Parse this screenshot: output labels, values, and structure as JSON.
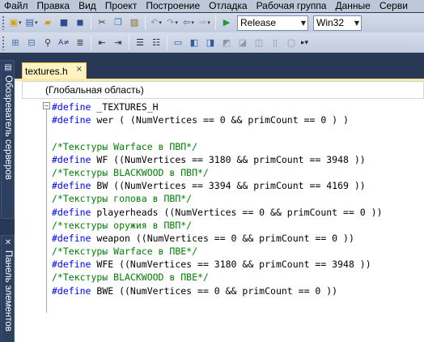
{
  "menubar": {
    "items": [
      "Файл",
      "Правка",
      "Вид",
      "Проект",
      "Построение",
      "Отладка",
      "Рабочая группа",
      "Данные",
      "Серви"
    ]
  },
  "toolbar1": {
    "configuration": "Release",
    "platform": "Win32"
  },
  "sidebar": {
    "tab1_label": "Обозреватель серверов",
    "tab2_label": "Панель элементов"
  },
  "document_tab": {
    "title": "textures.h",
    "close_glyph": "×"
  },
  "editor": {
    "scope": "(Глобальная область)",
    "lines": [
      {
        "parts": [
          {
            "t": "#define",
            "c": "kw"
          },
          {
            "t": " _TEXTURES_H",
            "c": ""
          }
        ]
      },
      {
        "parts": [
          {
            "t": "#define",
            "c": "kw"
          },
          {
            "t": " wer ( (NumVertices == 0 && primCount == 0 ) )",
            "c": ""
          }
        ]
      },
      {
        "parts": [
          {
            "t": "",
            "c": ""
          }
        ]
      },
      {
        "parts": [
          {
            "t": "/*Текстуры Warface в ПВП*/",
            "c": "cm"
          }
        ]
      },
      {
        "parts": [
          {
            "t": "#define",
            "c": "kw"
          },
          {
            "t": " WF ((NumVertices == 3180 && primCount == 3948 ))",
            "c": ""
          }
        ]
      },
      {
        "parts": [
          {
            "t": "/*Текстуры BLACKWOOD в ПВП*/",
            "c": "cm"
          }
        ]
      },
      {
        "parts": [
          {
            "t": "#define",
            "c": "kw"
          },
          {
            "t": " BW ((NumVertices == 3394 && primCount == 4169 ))",
            "c": ""
          }
        ]
      },
      {
        "parts": [
          {
            "t": "/*Текстуры голова в ПВП*/",
            "c": "cm"
          }
        ]
      },
      {
        "parts": [
          {
            "t": "#define",
            "c": "kw"
          },
          {
            "t": " playerheads ((NumVertices == 0 && primCount == 0 ))",
            "c": ""
          }
        ]
      },
      {
        "parts": [
          {
            "t": "/*текстуры оружия в ПВП*/",
            "c": "cm"
          }
        ]
      },
      {
        "parts": [
          {
            "t": "#define",
            "c": "kw"
          },
          {
            "t": " weapon ((NumVertices == 0 && primCount == 0 ))",
            "c": ""
          }
        ]
      },
      {
        "parts": [
          {
            "t": "/*Текстуры Warface в ПВЕ*/",
            "c": "cm"
          }
        ]
      },
      {
        "parts": [
          {
            "t": "#define",
            "c": "kw"
          },
          {
            "t": " WFE ((NumVertices == 3180 && primCount == 3948 ))",
            "c": ""
          }
        ]
      },
      {
        "parts": [
          {
            "t": "/*Текстуры BLACKWOOD в ПВЕ*/",
            "c": "cm"
          }
        ]
      },
      {
        "parts": [
          {
            "t": "#define",
            "c": "kw"
          },
          {
            "t": " BWE ((NumVertices == 0 && primCount == 0 ))",
            "c": ""
          }
        ]
      }
    ]
  },
  "colors": {
    "keyword": "#0000ff",
    "comment": "#008000",
    "frame": "#293955",
    "active_tab": "#fff4c0"
  }
}
